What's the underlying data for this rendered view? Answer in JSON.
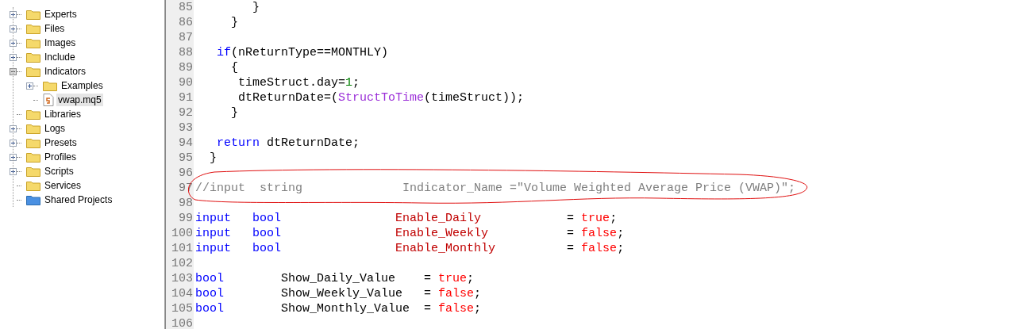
{
  "tree": {
    "items": [
      {
        "label": "Experts",
        "kind": "folder",
        "expanded": false,
        "selected": false
      },
      {
        "label": "Files",
        "kind": "folder",
        "expanded": false,
        "selected": false
      },
      {
        "label": "Images",
        "kind": "folder",
        "expanded": false,
        "selected": false
      },
      {
        "label": "Include",
        "kind": "folder",
        "expanded": false,
        "selected": false
      },
      {
        "label": "Indicators",
        "kind": "folder",
        "expanded": true,
        "selected": false,
        "children": [
          {
            "label": "Examples",
            "kind": "folder",
            "expanded": false,
            "selected": false
          },
          {
            "label": "vwap.mq5",
            "kind": "file",
            "selected": true
          }
        ]
      },
      {
        "label": "Libraries",
        "kind": "folder",
        "selected": false
      },
      {
        "label": "Logs",
        "kind": "folder",
        "expanded": false,
        "selected": false
      },
      {
        "label": "Presets",
        "kind": "folder",
        "expanded": false,
        "selected": false
      },
      {
        "label": "Profiles",
        "kind": "folder",
        "expanded": false,
        "selected": false
      },
      {
        "label": "Scripts",
        "kind": "folder",
        "expanded": false,
        "selected": false
      },
      {
        "label": "Services",
        "kind": "folder",
        "selected": false
      },
      {
        "label": "Shared Projects",
        "kind": "shared",
        "selected": false
      }
    ]
  },
  "editor": {
    "lines": [
      {
        "number": "85",
        "tokens": [
          {
            "kind": "plain",
            "text": "        }"
          }
        ]
      },
      {
        "number": "86",
        "tokens": [
          {
            "kind": "plain",
            "text": "     }"
          }
        ]
      },
      {
        "number": "87"
      },
      {
        "number": "88",
        "tokens": [
          {
            "kind": "keyword",
            "text": "   if"
          },
          {
            "kind": "plain",
            "text": "(nReturnType==MONTHLY)"
          }
        ]
      },
      {
        "number": "89",
        "tokens": [
          {
            "kind": "plain",
            "text": "     {"
          }
        ]
      },
      {
        "number": "90",
        "tokens": [
          {
            "kind": "plain",
            "text": "      timeStruct.day="
          },
          {
            "kind": "number",
            "text": "1"
          },
          {
            "kind": "plain",
            "text": ";"
          }
        ]
      },
      {
        "number": "91",
        "tokens": [
          {
            "kind": "plain",
            "text": "      dtReturnDate=("
          },
          {
            "kind": "function",
            "text": "StructToTime"
          },
          {
            "kind": "plain",
            "text": "(timeStruct));"
          }
        ]
      },
      {
        "number": "92",
        "tokens": [
          {
            "kind": "plain",
            "text": "     }"
          }
        ]
      },
      {
        "number": "93"
      },
      {
        "number": "94",
        "tokens": [
          {
            "kind": "keyword",
            "text": "   return"
          },
          {
            "kind": "plain",
            "text": " dtReturnDate;"
          }
        ]
      },
      {
        "number": "95",
        "tokens": [
          {
            "kind": "plain",
            "text": "  }"
          }
        ]
      },
      {
        "number": "96"
      },
      {
        "number": "97",
        "circled": true,
        "tokens": [
          {
            "kind": "comment",
            "text": "//input  string              Indicator_Name =\"Volume Weighted Average Price (VWAP)\";"
          }
        ]
      },
      {
        "number": "98"
      },
      {
        "number": "99",
        "tokens": [
          {
            "kind": "keyword",
            "text": "input   bool                "
          },
          {
            "kind": "variable",
            "text": "Enable_Daily"
          },
          {
            "kind": "plain",
            "text": "            = "
          },
          {
            "kind": "value",
            "text": "true"
          },
          {
            "kind": "plain",
            "text": ";"
          }
        ]
      },
      {
        "number": "100",
        "tokens": [
          {
            "kind": "keyword",
            "text": "input   bool                "
          },
          {
            "kind": "variable",
            "text": "Enable_Weekly"
          },
          {
            "kind": "plain",
            "text": "           = "
          },
          {
            "kind": "value",
            "text": "false"
          },
          {
            "kind": "plain",
            "text": ";"
          }
        ]
      },
      {
        "number": "101",
        "tokens": [
          {
            "kind": "keyword",
            "text": "input   bool                "
          },
          {
            "kind": "variable",
            "text": "Enable_Monthly"
          },
          {
            "kind": "plain",
            "text": "          = "
          },
          {
            "kind": "value",
            "text": "false"
          },
          {
            "kind": "plain",
            "text": ";"
          }
        ]
      },
      {
        "number": "102"
      },
      {
        "number": "103",
        "tokens": [
          {
            "kind": "keyword",
            "text": "bool"
          },
          {
            "kind": "plain",
            "text": "        Show_Daily_Value    = "
          },
          {
            "kind": "value",
            "text": "true"
          },
          {
            "kind": "plain",
            "text": ";"
          }
        ]
      },
      {
        "number": "104",
        "tokens": [
          {
            "kind": "keyword",
            "text": "bool"
          },
          {
            "kind": "plain",
            "text": "        Show_Weekly_Value   = "
          },
          {
            "kind": "value",
            "text": "false"
          },
          {
            "kind": "plain",
            "text": ";"
          }
        ]
      },
      {
        "number": "105",
        "tokens": [
          {
            "kind": "keyword",
            "text": "bool"
          },
          {
            "kind": "plain",
            "text": "        Show_Monthly_Value  = "
          },
          {
            "kind": "value",
            "text": "false"
          },
          {
            "kind": "plain",
            "text": ";"
          }
        ]
      },
      {
        "number": "106"
      }
    ]
  }
}
